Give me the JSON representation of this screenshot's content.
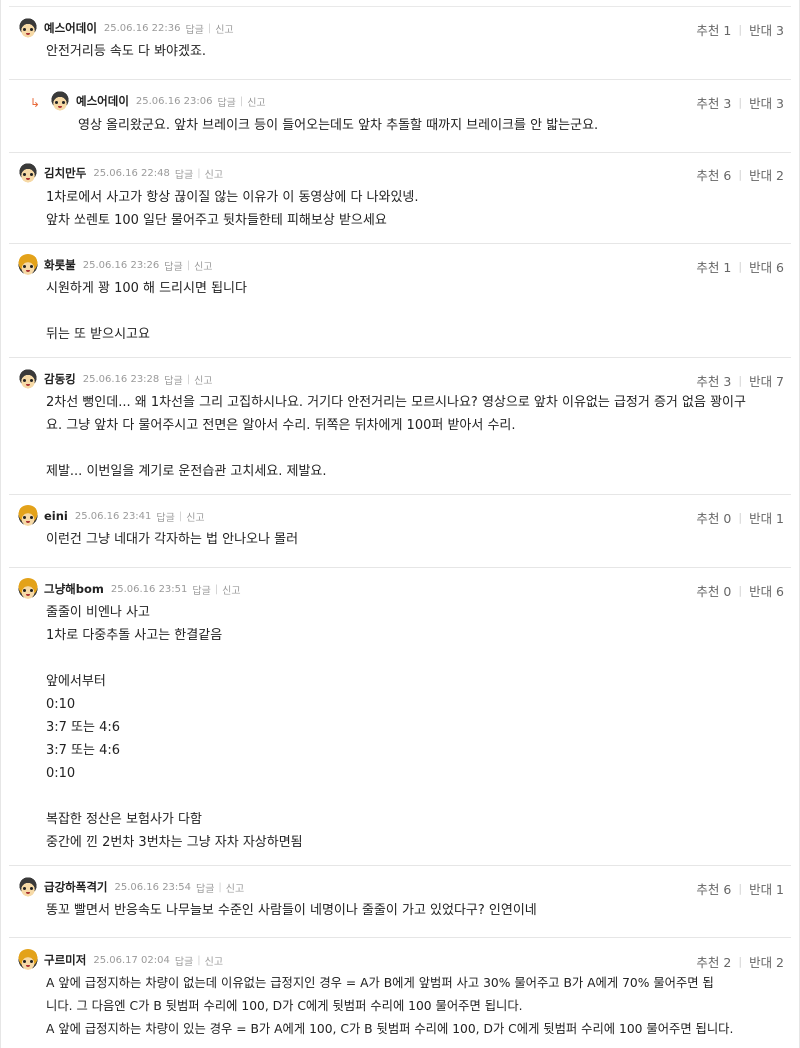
{
  "comments": [
    {
      "nick": "예스어데이",
      "date": "25.06.16 22:36",
      "reply": "답글",
      "report": "신고",
      "up": "추천 1",
      "down": "반대 3",
      "lines": [
        "안전거리등 속도 다 봐야겠죠."
      ]
    },
    {
      "nick": "예스어데이",
      "date": "25.06.16 23:06",
      "reply": "답글",
      "report": "신고",
      "up": "추천 3",
      "down": "반대 3",
      "lines": [
        "영상 올리왔군요. 앞차 브레이크 등이 들어오는데도 앞차 추돌할 때까지 브레이크를 안 밟는군요."
      ]
    },
    {
      "nick": "김치만두",
      "date": "25.06.16 22:48",
      "reply": "답글",
      "report": "신고",
      "up": "추천 6",
      "down": "반대 2",
      "lines": [
        "1차로에서 사고가 항상 끊이질 않는 이유가 이 동영상에 다 나와있넹.",
        "앞차 쏘렌토 100 일단 물어주고 뒷차들한테 피해보상 받으세요"
      ]
    },
    {
      "nick": "화롯불",
      "date": "25.06.16 23:26",
      "reply": "답글",
      "report": "신고",
      "up": "추천 1",
      "down": "반대 6",
      "lines": [
        "시원하게 꽝 100 해 드리시면 됩니다",
        "",
        "뒤는 또 받으시고요"
      ]
    },
    {
      "nick": "감동킹",
      "date": "25.06.16 23:28",
      "reply": "답글",
      "report": "신고",
      "up": "추천 3",
      "down": "반대 7",
      "lines": [
        "2차선 뻥인데... 왜 1차선을 그리 고집하시나요. 거기다 안전거리는 모르시나요? 영상으로 앞차 이유없는 급정거 증거 없음 꽝이구",
        "요. 그냥 앞차 다 물어주시고 전면은 알아서 수리. 뒤쪽은 뒤차에게 100퍼 받아서 수리.",
        "",
        "제발... 이번일을 계기로 운전습관 고치세요. 제발요."
      ]
    },
    {
      "nick": "eini",
      "date": "25.06.16 23:41",
      "reply": "답글",
      "report": "신고",
      "up": "추천 0",
      "down": "반대 1",
      "lines": [
        "이런건 그냥 네대가 각자하는 법 안나오나 몰러"
      ]
    },
    {
      "nick": "그냥해bom",
      "date": "25.06.16 23:51",
      "reply": "답글",
      "report": "신고",
      "up": "추천 0",
      "down": "반대 6",
      "lines": [
        "줄줄이 비엔나 사고",
        "1차로 다중추돌 사고는 한결같음",
        "",
        "앞에서부터",
        "0:10",
        "3:7 또는 4:6",
        "3:7 또는 4:6",
        "0:10",
        "",
        "복잡한 정산은 보험사가 다함",
        "중간에 낀 2번차 3번차는 그냥 자차 자상하면됨"
      ]
    },
    {
      "nick": "급강하폭격기",
      "date": "25.06.16 23:54",
      "reply": "답글",
      "report": "신고",
      "up": "추천 6",
      "down": "반대 1",
      "lines": [
        "똥꼬 빨면서 반응속도 나무늘보 수준인 사람들이 네명이나 줄줄이 가고 있었다구? 인연이네"
      ]
    },
    {
      "nick": "구르미저",
      "date": "25.06.17 02:04",
      "reply": "답글",
      "report": "신고",
      "up": "추천 2",
      "down": "반대 2",
      "lines": [
        "A 앞에 급정지하는 차량이 없는데 이유없는 급정지인 경우 = A가 B에게 앞범퍼 사고 30% 물어주고 B가 A에게 70% 물어주면 됩",
        "니다. 그 다음엔 C가 B 뒷범퍼 수리에 100, D가 C에게 뒷범퍼 수리에 100 물어주면 됩니다.",
        "A 앞에 급정지하는 차량이 있는 경우 = B가 A에게 100, C가 B 뒷범퍼 수리에 100, D가 C에게 뒷범퍼 수리에 100 물어주면 됩니다."
      ]
    }
  ]
}
